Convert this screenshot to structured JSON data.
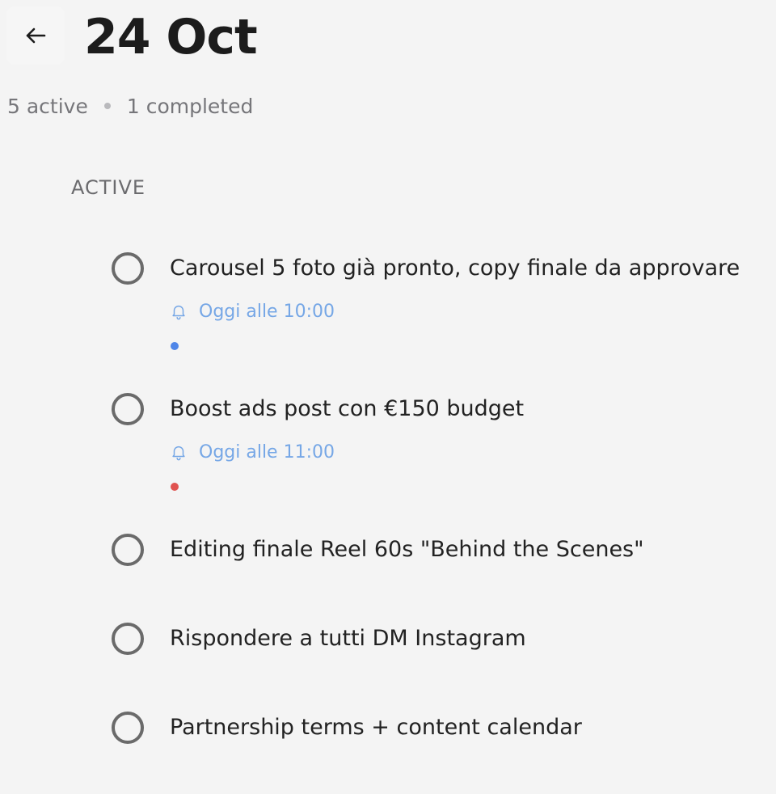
{
  "header": {
    "back_icon": "arrow-left-icon",
    "title": "24 Oct"
  },
  "summary": {
    "active": "5 active",
    "completed": "1 completed"
  },
  "section": {
    "label": "ACTIVE"
  },
  "tasks": [
    {
      "title": "Carousel 5 foto già pronto, copy finale da approvare",
      "reminder": "Oggi alle 10:00",
      "reminder_icon": "bell-icon",
      "tag_color": "#4f86e8"
    },
    {
      "title": "Boost ads post con €150 budget",
      "reminder": "Oggi alle 11:00",
      "reminder_icon": "bell-icon",
      "tag_color": "#e0524f"
    },
    {
      "title": "Editing finale Reel 60s \"Behind the Scenes\""
    },
    {
      "title": "Rispondere a tutti DM Instagram"
    },
    {
      "title": "Partnership terms + content calendar"
    }
  ],
  "colors": {
    "background": "#f4f4f4",
    "reminder_text": "#76a7e6",
    "checkbox_border": "#6a6a6a"
  }
}
